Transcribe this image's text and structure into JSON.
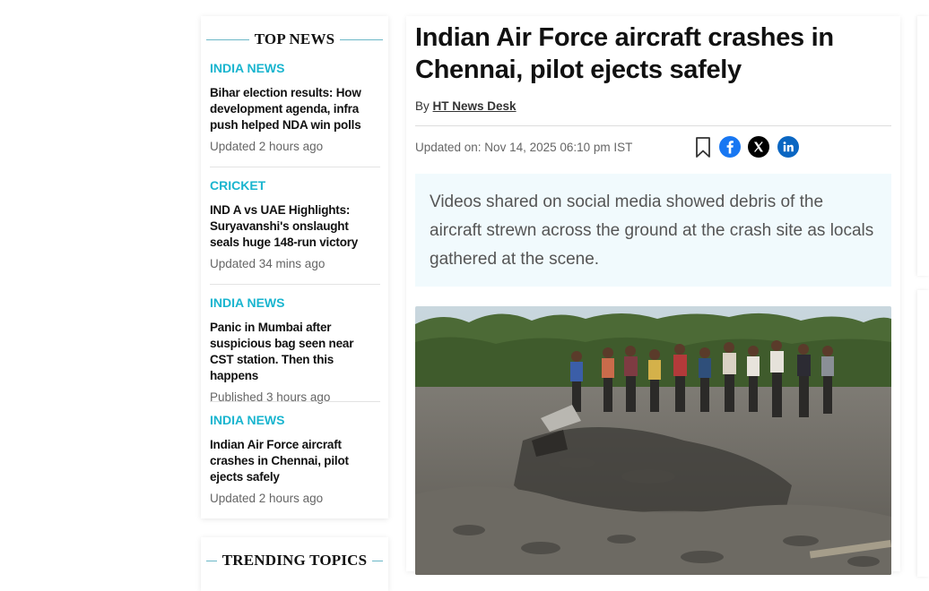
{
  "top_news": {
    "title": "TOP NEWS",
    "items": [
      {
        "category": "INDIA NEWS",
        "headline": "Bihar election results: How development agenda, infra push helped NDA win polls",
        "time": "Updated 2 hours ago"
      },
      {
        "category": "CRICKET",
        "headline": "IND A vs UAE Highlights: Suryavanshi's onslaught seals huge 148-run victory",
        "time": "Updated 34 mins ago"
      },
      {
        "category": "INDIA NEWS",
        "headline": "Panic in Mumbai after suspicious bag seen near CST station. Then this happens",
        "time": "Published 3 hours ago"
      },
      {
        "category": "INDIA NEWS",
        "headline": "Indian Air Force aircraft crashes in Chennai, pilot ejects safely",
        "time": "Updated 2 hours ago"
      }
    ]
  },
  "trending": {
    "title": "TRENDING TOPICS"
  },
  "article": {
    "headline": "Indian Air Force aircraft crashes in Chennai, pilot ejects safely",
    "by_prefix": "By",
    "author": "HT News Desk",
    "updated": "Updated on: Nov 14, 2025 06:10 pm IST",
    "summary": "Videos shared on social media showed debris of the aircraft strewn across the ground at the crash site as locals gathered at the scene.",
    "share_icons": [
      "bookmark-icon",
      "facebook-icon",
      "x-icon",
      "linkedin-icon"
    ]
  },
  "colors": {
    "category": "#1ab5cf",
    "summary_bg": "#f1fafd",
    "facebook": "#1877f2",
    "x": "#000000",
    "linkedin": "#0a66c2"
  }
}
